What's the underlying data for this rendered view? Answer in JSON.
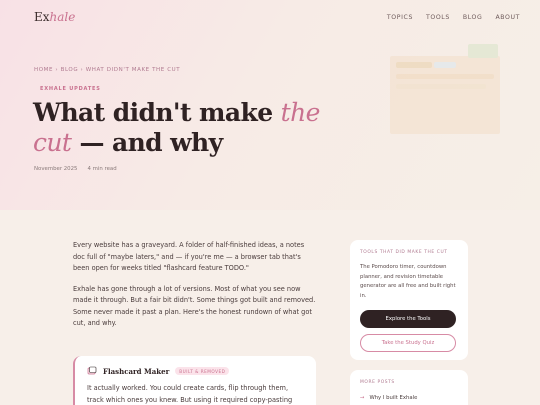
{
  "brand": {
    "prefix": "Ex",
    "accent": "hale"
  },
  "nav": {
    "items": [
      "TOPICS",
      "TOOLS",
      "BLOG",
      "ABOUT"
    ]
  },
  "breadcrumb": "HOME  ›  BLOG  ›  WHAT DIDN'T MAKE THE CUT",
  "kicker": "EXHALE UPDATES",
  "title": {
    "pre": "What didn't make ",
    "highlight": "the cut",
    "post": " — and why"
  },
  "meta": {
    "date": "November 2025",
    "read_time": "4 min read"
  },
  "article": {
    "paragraphs": [
      "Every website has a graveyard. A folder of half-finished ideas, a notes doc full of \"maybe laters,\" and — if you're me — a browser tab that's been open for weeks titled \"flashcard feature TODO.\"",
      "Exhale has gone through a lot of versions. Most of what you see now made it through. But a fair bit didn't. Some things got built and removed. Some never made it past a plan. Here's the honest rundown of what got cut, and why."
    ]
  },
  "card": {
    "title": "Flashcard Maker",
    "badge": "BUILT & REMOVED",
    "body": "It actually worked. You could create cards, flip through them, track which ones you knew. But using it required copy-pasting your"
  },
  "sidebar": {
    "label": "TOOLS THAT DID MAKE THE CUT",
    "text": "The Pomodoro timer, countdown planner, and revision timetable generator are all free and built right in.",
    "primary_button": "Explore the Tools",
    "secondary_button": "Take the Study Quiz"
  },
  "more_posts": {
    "label": "MORE POSTS",
    "items": [
      "Why I built Exhale"
    ]
  },
  "colors": {
    "accent": "#c9718f",
    "dark": "#2f2223",
    "bg": "#f7efe9"
  }
}
